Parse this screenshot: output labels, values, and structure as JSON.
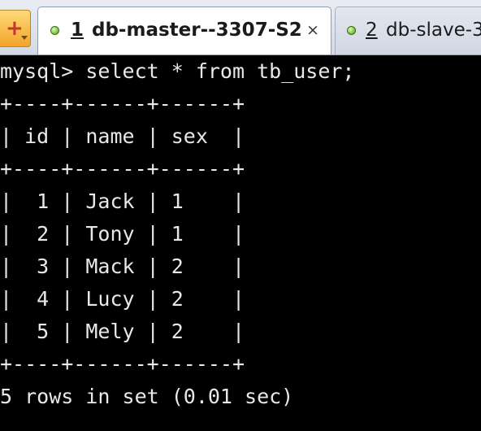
{
  "tabs": [
    {
      "number": "1",
      "label": "db-master--3307-S2",
      "close": "×",
      "active": true,
      "status_color": "#4a9a12"
    },
    {
      "number": "2",
      "label": "db-slave-3",
      "active": false,
      "status_color": "#4a9a12"
    }
  ],
  "new_tab_button": {
    "icon": "plus-icon",
    "glyph": "+"
  },
  "terminal": {
    "prompt": "mysql> select * from tb_user;",
    "border": "+----+------+------+",
    "header": "| id | name | sex  |",
    "rows": [
      "|  1 | Jack | 1    |",
      "|  2 | Tony | 1    |",
      "|  3 | Mack | 2    |",
      "|  4 | Lucy | 2    |",
      "|  5 | Mely | 2    |"
    ],
    "footer": "5 rows in set (0.01 sec)",
    "text_color": "#e8e8e8",
    "background": "#000000"
  }
}
